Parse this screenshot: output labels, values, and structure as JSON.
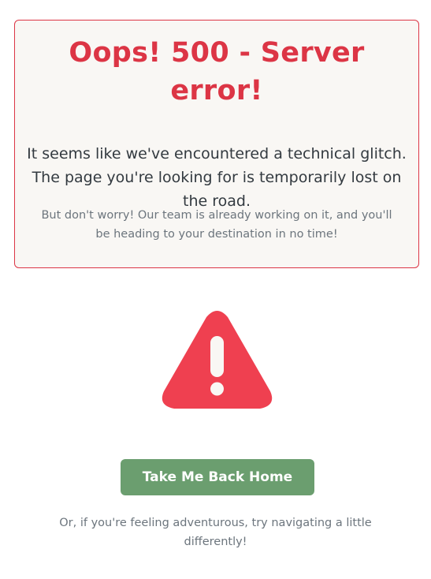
{
  "error": {
    "title": "Oops! 500 - Server error!",
    "lead": "It seems like we've encountered a technical glitch. The page you're looking for is temporarily lost on the road.",
    "note": "But don't worry! Our team is already working on it, and you'll be heading to your destination in no time!"
  },
  "icon": {
    "name": "warning-triangle-icon",
    "color": "#ef4050"
  },
  "actions": {
    "home_button_label": "Take Me Back Home"
  },
  "footer": {
    "text": "Or, if you're feeling adventurous, try navigating a little differently!"
  },
  "colors": {
    "accent": "#dc3545",
    "button": "#6b9e6f",
    "card_background": "#f9f7f4",
    "muted_text": "#6c757d"
  }
}
